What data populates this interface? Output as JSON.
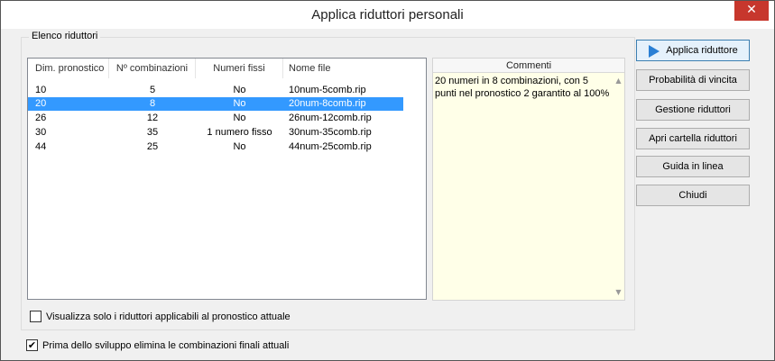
{
  "window": {
    "title": "Applica riduttori personali",
    "close_glyph": "✕"
  },
  "group": {
    "legend": "Elenco riduttori"
  },
  "table": {
    "columns": [
      "Dim. pronostico",
      "Nº combinazioni",
      "Numeri fissi",
      "Nome file"
    ],
    "rows": [
      {
        "dim": "10",
        "comb": "5",
        "fissi": "No",
        "file": "10num-5comb.rip",
        "selected": false
      },
      {
        "dim": "20",
        "comb": "8",
        "fissi": "No",
        "file": "20num-8comb.rip",
        "selected": true
      },
      {
        "dim": "26",
        "comb": "12",
        "fissi": "No",
        "file": "26num-12comb.rip",
        "selected": false
      },
      {
        "dim": "30",
        "comb": "35",
        "fissi": "1 numero fisso",
        "file": "30num-35comb.rip",
        "selected": false
      },
      {
        "dim": "44",
        "comb": "25",
        "fissi": "No",
        "file": "44num-25comb.rip",
        "selected": false
      }
    ]
  },
  "comments": {
    "header": "Commenti",
    "text": "20 numeri in 8 combinazioni, con 5 punti nel pronostico 2 garantito al 100%"
  },
  "checkboxes": {
    "only_applicable": {
      "label": "Visualizza solo i riduttori applicabili al pronostico attuale",
      "checked": false
    },
    "delete_combinations": {
      "label": "Prima dello sviluppo elimina le combinazioni finali attuali",
      "checked": true,
      "glyph": "✔"
    }
  },
  "buttons": {
    "apply": "Applica riduttore",
    "probability": "Probabilità di vincita",
    "manage": "Gestione riduttori",
    "open_folder": "Apri cartella riduttori",
    "help": "Guida in linea",
    "close": "Chiudi"
  },
  "icons": {
    "apply": "play-icon",
    "close": "close-icon"
  },
  "colors": {
    "selection": "#3399ff",
    "comments_bg": "#ffffe8",
    "close_button": "#c7372d"
  }
}
